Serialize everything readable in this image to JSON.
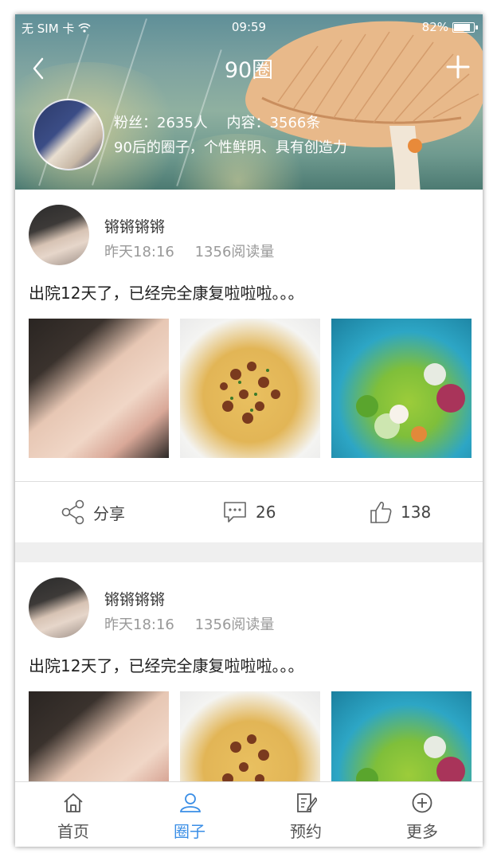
{
  "status_bar": {
    "carrier": "无 SIM 卡",
    "time": "09:59",
    "battery": "82%"
  },
  "header": {
    "title": "90圈",
    "fans_label": "粉丝：2635人",
    "content_label": "内容：3566条",
    "description": "90后的圈子，个性鲜明、具有创造力"
  },
  "posts": [
    {
      "username": "锵锵锵锵",
      "time": "昨天18:16",
      "reads": "1356阅读量",
      "text": "出院12天了，已经完全康复啦啦啦。。。",
      "share_label": "分享",
      "comments": "26",
      "likes": "138"
    },
    {
      "username": "锵锵锵锵",
      "time": "昨天18:16",
      "reads": "1356阅读量",
      "text": "出院12天了，已经完全康复啦啦啦。。。"
    }
  ],
  "tabbar": {
    "items": [
      {
        "label": "首页",
        "icon": "home-icon"
      },
      {
        "label": "圈子",
        "icon": "people-icon"
      },
      {
        "label": "预约",
        "icon": "edit-note-icon"
      },
      {
        "label": "更多",
        "icon": "plus-circle-icon"
      }
    ],
    "active_color": "#3a8ee6"
  }
}
